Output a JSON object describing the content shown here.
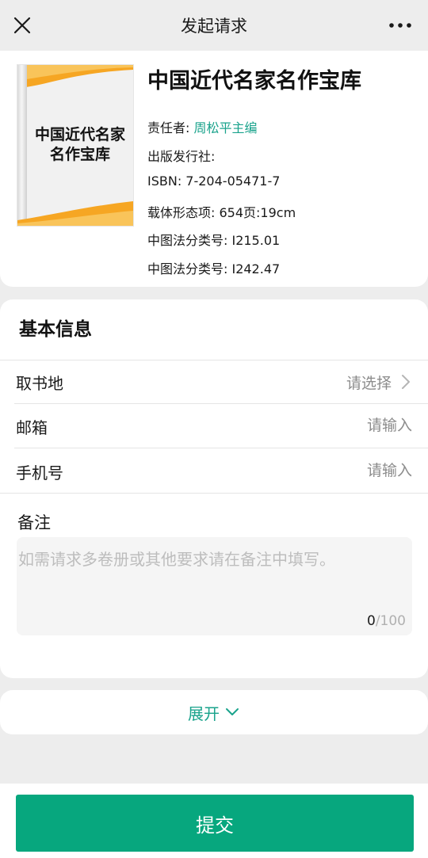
{
  "header": {
    "title": "发起请求",
    "close_icon": "close-icon",
    "more_icon": "more-dots-icon"
  },
  "book": {
    "cover_title": "中国近代名家名作宝库",
    "title": "中国近代名家名作宝库",
    "responsible_label": "责任者: ",
    "responsible_value": "周松平主编",
    "publisher": "出版发行社:",
    "isbn": "ISBN: 7-204-05471-7",
    "carrier": "载体形态项: 654页:19cm",
    "class_1": "中图法分类号: I215.01",
    "class_2": "中图法分类号: I242.47"
  },
  "form": {
    "section_title": "基本信息",
    "pickup": {
      "label": "取书地",
      "hint": "请选择"
    },
    "email": {
      "label": "邮箱",
      "placeholder": "请输入"
    },
    "phone": {
      "label": "手机号",
      "placeholder": "请输入"
    },
    "notes": {
      "label": "备注",
      "placeholder": "如需请求多卷册或其他要求请在备注中填写。",
      "count": "0",
      "max": "/100"
    }
  },
  "expand": {
    "label": "展开"
  },
  "submit": {
    "label": "提交"
  },
  "colors": {
    "accent": "#1aa38c",
    "submit": "#07a77e",
    "background": "#ededed"
  }
}
